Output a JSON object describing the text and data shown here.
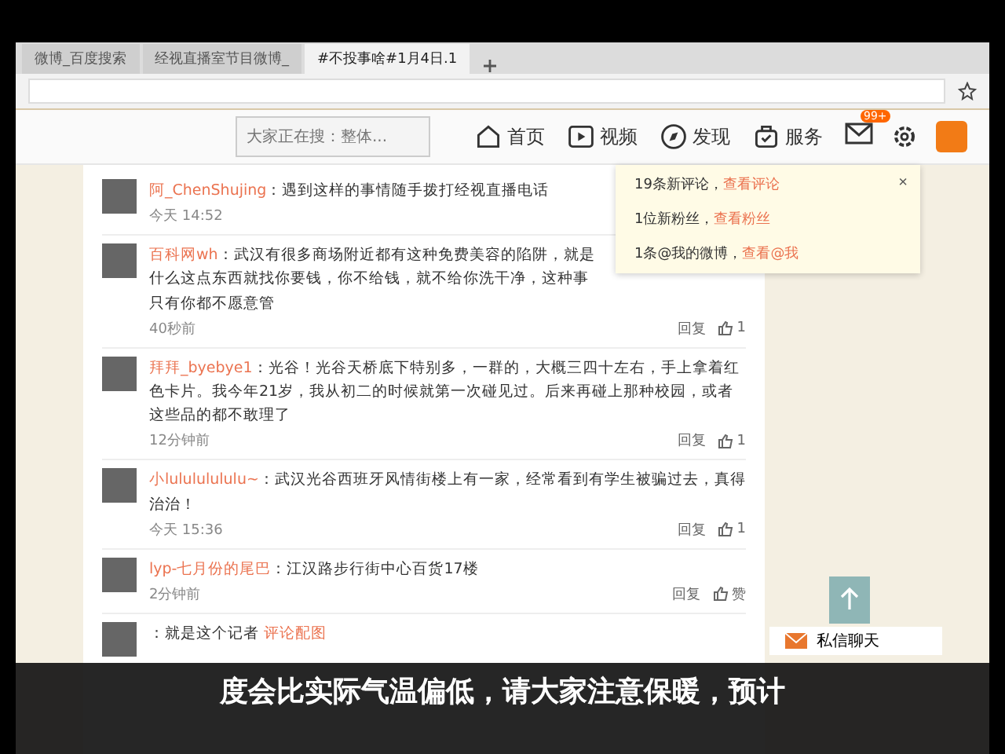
{
  "browser": {
    "tabs": [
      {
        "title": "微博_百度搜索",
        "selected": false
      },
      {
        "title": "经视直播室节目微博_",
        "selected": false
      },
      {
        "title": "#不投事啥#1月4日.1",
        "selected": true
      }
    ]
  },
  "nav": {
    "search": {
      "placeholder": "大家正在搜：整体..."
    },
    "items": [
      {
        "label": "首页"
      },
      {
        "label": "视频"
      },
      {
        "label": "发现"
      },
      {
        "label": "服务"
      }
    ],
    "message_badge": "99+"
  },
  "comments": [
    {
      "user": "阿_ChenShujing",
      "text": "：遇到这样的事情随手拨打经视直播电话",
      "time": "今天 14:52"
    },
    {
      "user": "百科网wh",
      "text": "：武汉有很多商场附近都有这种免费美容的陷阱，就是什么这点东西就找你要钱，你不给钱，就不给你洗干净，这种事只有你都不愿意管",
      "time": "40秒前",
      "reply": "回复",
      "likes": "1"
    },
    {
      "user": "拜拜_byebye1",
      "text": "：光谷！光谷天桥底下特别多，一群的，大概三四十左右，手上拿着红色卡片。我今年21岁，我从初二的时候就第一次碰见过。后来再碰上那种校园，或者这些品的都不敢理了",
      "time": "12分钟前",
      "reply": "回复",
      "likes": "1"
    },
    {
      "user": "小lulululululu~",
      "text": "：武汉光谷西班牙风情街楼上有一家，经常看到有学生被骗过去，真得治治！",
      "time": "今天 15:36",
      "reply": "回复",
      "likes": "1"
    },
    {
      "user": "lyp-七月份的尾巴",
      "text": "：江汉路步行街中心百货17楼",
      "time": "2分钟前",
      "reply": "回复",
      "likes": "赞"
    },
    {
      "text": "：就是这个记者",
      "link": "评论配图"
    }
  ],
  "notifications": [
    {
      "text": "19条新评论，",
      "link": "查看评论"
    },
    {
      "text": "1位新粉丝，",
      "link": "查看粉丝"
    },
    {
      "text": "1条@我的微博，",
      "link": "查看@我"
    }
  ],
  "notification_close": "×",
  "chat": {
    "label": "私信聊天"
  },
  "subtitle": "度会比实际气温偏低，请大家注意保暖，预计"
}
